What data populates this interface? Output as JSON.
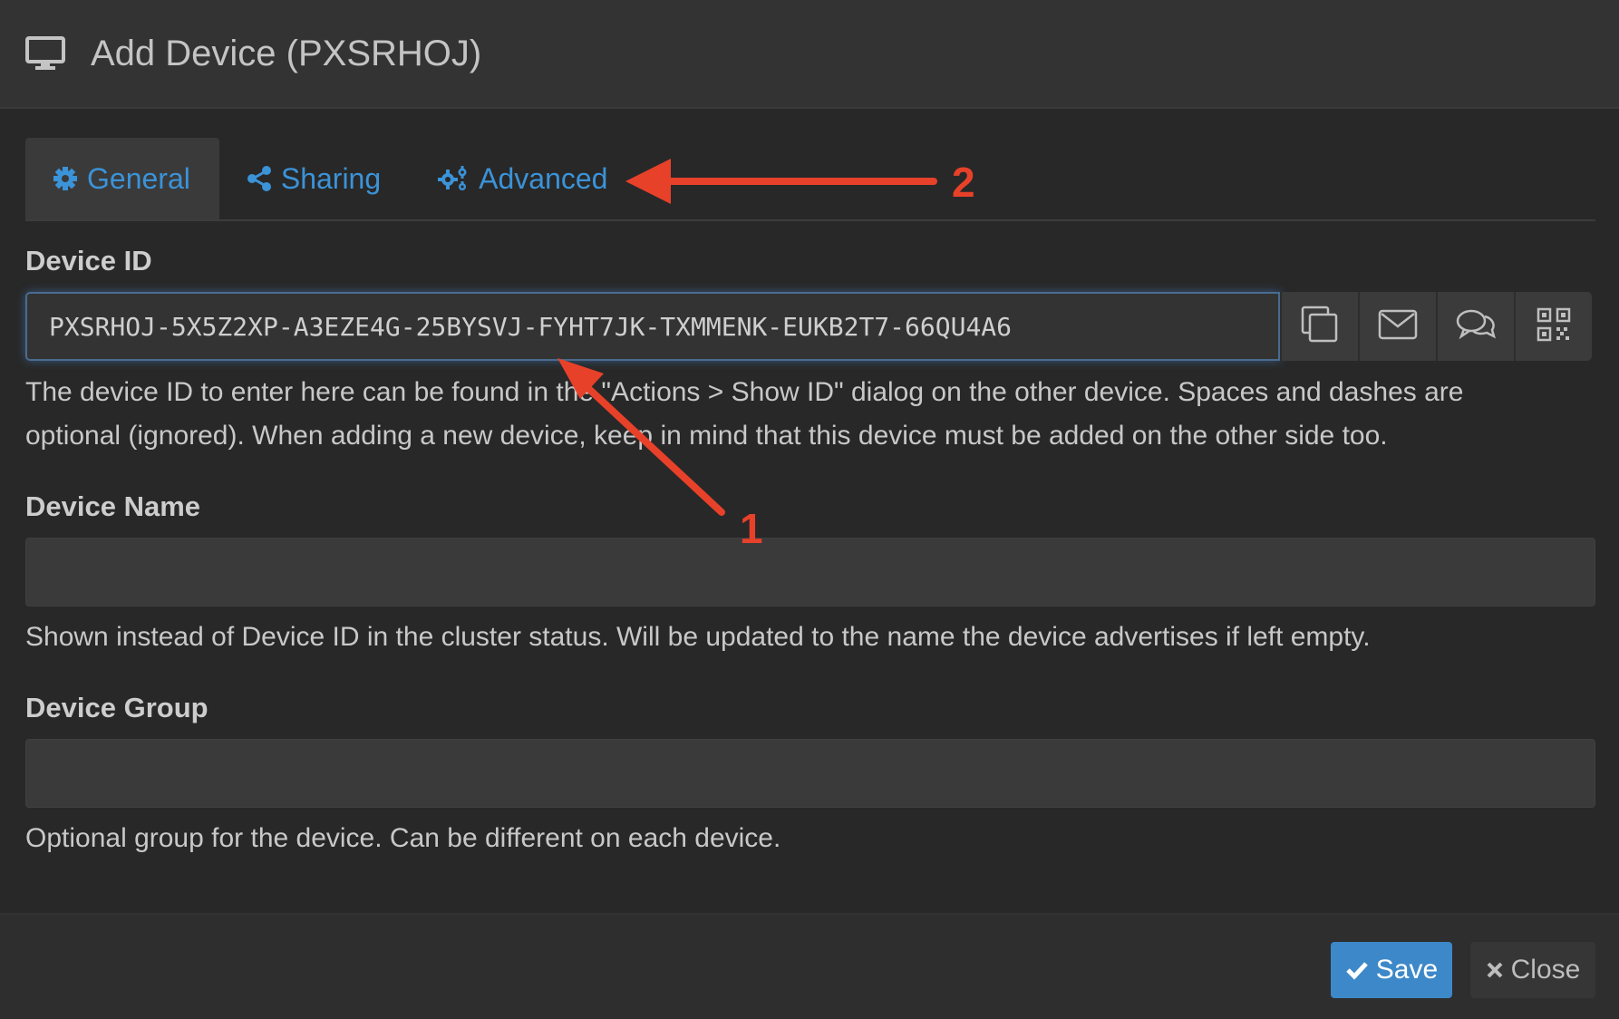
{
  "dialog": {
    "title": "Add Device (PXSRHOJ)",
    "icon": "monitor-icon"
  },
  "tabs": [
    {
      "label": "General",
      "icon": "gear-icon",
      "active": true
    },
    {
      "label": "Sharing",
      "icon": "share-icon",
      "active": false
    },
    {
      "label": "Advanced",
      "icon": "gears-icon",
      "active": false
    }
  ],
  "device_id": {
    "label": "Device ID",
    "value": "PXSRHOJ-5X5Z2XP-A3EZE4G-25BYSVJ-FYHT7JK-TXMMENK-EUKB2T7-66QU4A6",
    "help_line1": "The device ID to enter here can be found in the \"Actions > Show ID\" dialog on the other device. Spaces and dashes are",
    "help_line2": "optional (ignored). When adding a new device, keep in mind that this device must be added on the other side too.",
    "actions": [
      "copy-icon",
      "email-icon",
      "chat-icon",
      "qr-code-icon"
    ]
  },
  "device_name": {
    "label": "Device Name",
    "value": "",
    "help": "Shown instead of Device ID in the cluster status. Will be updated to the name the device advertises if left empty."
  },
  "device_group": {
    "label": "Device Group",
    "value": "",
    "help": "Optional group for the device. Can be different on each device."
  },
  "footer": {
    "save_label": "Save",
    "close_label": "Close"
  },
  "annotations": {
    "marker_1": "1",
    "marker_2": "2",
    "color": "#e8412a"
  },
  "colors": {
    "accent": "#3b93d8",
    "save_button": "#3d88c8"
  }
}
